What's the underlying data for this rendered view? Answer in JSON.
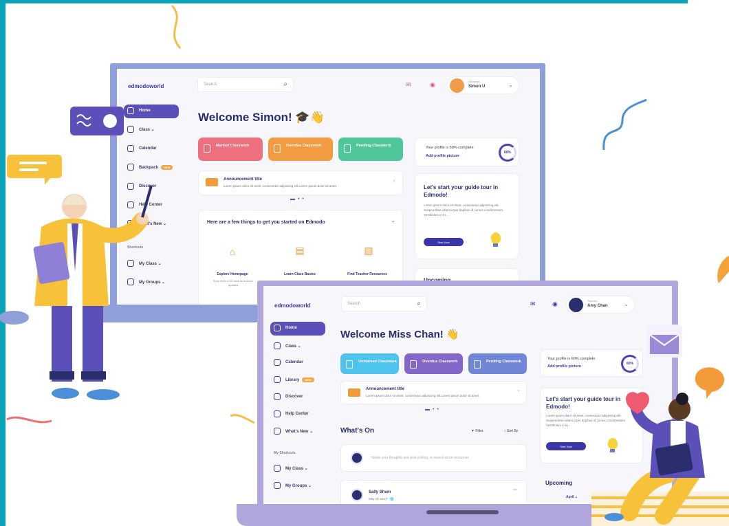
{
  "laptop1": {
    "logo": "edmodoworld",
    "search_placeholder": "Search",
    "user": {
      "greeting": "Welcome",
      "name": "Simon U"
    },
    "sidebar": [
      {
        "label": "Home",
        "active": true,
        "badge": ""
      },
      {
        "label": "Class",
        "active": false,
        "badge": ""
      },
      {
        "label": "Calendar",
        "active": false,
        "badge": ""
      },
      {
        "label": "Backpack",
        "active": false,
        "badge": "NEW"
      },
      {
        "label": "Discover",
        "active": false,
        "badge": ""
      },
      {
        "label": "Help Center",
        "active": false,
        "badge": ""
      },
      {
        "label": "What's New",
        "active": false,
        "badge": ""
      }
    ],
    "sidebar_section": "Shortcuts",
    "sidebar_shortcuts": [
      "My Class",
      "My Groups"
    ],
    "welcome": "Welcome Simon! 🎓👋",
    "cards": [
      {
        "label": "Marked Classwork",
        "color": "#ee6f7d"
      },
      {
        "label": "Overdue Classwork",
        "color": "#f39b42"
      },
      {
        "label": "Pending Classwork",
        "color": "#4fc79a"
      }
    ],
    "announcement": {
      "title": "Announcement title",
      "text": "Lorem ipsum dolor sit amet, consectetur adipiscing elit.Lorem ipsum dolor sit amet."
    },
    "profile": {
      "text": "Your profile is 60% complete",
      "link": "Add profile picture",
      "percent": "60%"
    },
    "tour": {
      "title": "Let's start your guide tour in Edmodo!",
      "text": "Lorem ipsum dolor sit amet, consectetur adipiscing elit. Suspendisse ullamcorper dapibus id cursus condimentum. Vestibulum in tu...",
      "button": "Start Now"
    },
    "upcoming": "Upcoming",
    "getting_started": {
      "title": "Here are a few things to get you started on Edmodo",
      "items": [
        {
          "label": "Explore Homepage",
          "sub": "Snap them & 20 desk and school updates"
        },
        {
          "label": "Learn Class Basics",
          "sub": ""
        },
        {
          "label": "Find Teacher Resources",
          "sub": ""
        }
      ]
    }
  },
  "laptop2": {
    "logo": "edmodoworld",
    "search_placeholder": "Search",
    "user": {
      "greeting": "Teacher",
      "name": "Amy Chan"
    },
    "sidebar": [
      {
        "label": "Home",
        "active": true,
        "badge": ""
      },
      {
        "label": "Class",
        "active": false,
        "badge": ""
      },
      {
        "label": "Calendar",
        "active": false,
        "badge": ""
      },
      {
        "label": "Library",
        "active": false,
        "badge": "NEW"
      },
      {
        "label": "Discover",
        "active": false,
        "badge": ""
      },
      {
        "label": "Help Center",
        "active": false,
        "badge": ""
      },
      {
        "label": "What's New",
        "active": false,
        "badge": ""
      }
    ],
    "sidebar_section": "My Shortcuts",
    "sidebar_shortcuts": [
      "My Class",
      "My Groups"
    ],
    "welcome": "Welcome Miss Chan! 👋",
    "cards": [
      {
        "label": "Unmarked Classwork",
        "color": "#4ec3ec"
      },
      {
        "label": "Overdue Classwork",
        "color": "#8366c8"
      },
      {
        "label": "Pending Classwork",
        "color": "#6f86d6"
      }
    ],
    "announcement": {
      "title": "Announcement title",
      "text": "Lorem ipsum dolor sit amet, consectetur adipiscing elit.Lorem ipsum dolor sit amet."
    },
    "profile": {
      "text": "Your profile is 60% complete",
      "link": "Add profile picture",
      "percent": "60%"
    },
    "tour": {
      "title": "Let's start your guide tour in Edmodo!",
      "text": "Lorem ipsum dolor sit amet, consectetur adipiscing elit. Suspendisse ullamcorper dapibus id cursus condimentum. Vestibulum in tu...",
      "button": "Start Now"
    },
    "whats_on": "What's On",
    "filter": "Filter",
    "sort": "Sort By",
    "composer": "Share your thoughts and post a thing, or search more resources",
    "post": {
      "author": "Sally Shum",
      "meta": "May 16 10:47 · 🌐"
    },
    "upcoming": "Upcoming",
    "upcoming_month": "April"
  }
}
